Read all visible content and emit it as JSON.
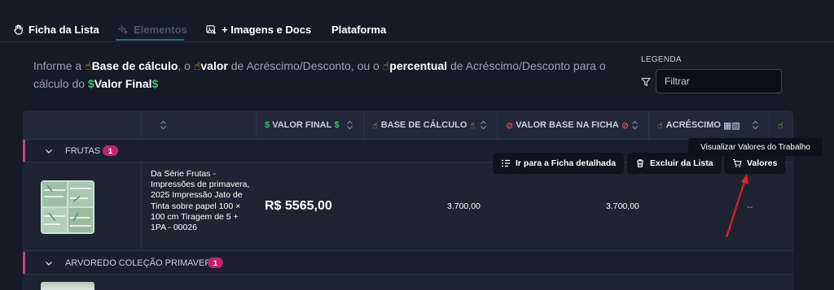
{
  "tabs": [
    {
      "label": "Ficha da Lista",
      "icon": "hand-icon",
      "active": false
    },
    {
      "label": "Elementos",
      "icon": "sparkle-icon",
      "active": true
    },
    {
      "label": "+ Imagens e Docs",
      "icon": "image-add-icon",
      "active": false
    },
    {
      "label": "Plataforma",
      "icon": "",
      "active": false
    }
  ],
  "info": {
    "p1": "Informe a ",
    "base": "Base de cálculo",
    "p2": ", o ",
    "valor": "valor",
    "p3": " de Acréscimo/Desconto, ou o ",
    "percentual": "percentual",
    "p4": " de Acréscimo/Desconto para o cálculo do ",
    "valor_final": "Valor Final"
  },
  "legend": {
    "label": "LEGENDA",
    "filter_placeholder": "Filtrar"
  },
  "table": {
    "headers": [
      {
        "label": "VALOR FINAL",
        "emoji": "dollar"
      },
      {
        "label": "BASE DE CÁLCULO",
        "emoji": "hand"
      },
      {
        "label": "VALOR BASE NA FICHA",
        "emoji": "no"
      },
      {
        "label": "ACRÉSCIMO",
        "emoji": "hand"
      }
    ],
    "groups": [
      {
        "title": "FRUTAS",
        "count": "1"
      },
      {
        "title": "ARVOREDO COLEÇÃO PRIMAVERA",
        "count": "1"
      }
    ],
    "row": {
      "description": "Da Série Frutas - Impressões de primavera, 2025 Impressão Jato de Tinta sobre papel 100 × 100 cm Tiragem de 5 + 1PA - 00026",
      "valor_final": "R$ 5565,00",
      "base_calculo": "3.700,00",
      "valor_base_ficha": "3.700,00",
      "acrescimo": "--"
    }
  },
  "actions": {
    "ficha": "Ir para a Ficha detalhada",
    "excluir": "Excluir da Lista",
    "valores": "Valores",
    "tooltip": "Visualizar Valores do Trabalho"
  },
  "colors": {
    "accent": "#2e6f73",
    "group_bar": "#d03b8a",
    "badge": "#c0246a",
    "arrow": "#e0202a"
  }
}
